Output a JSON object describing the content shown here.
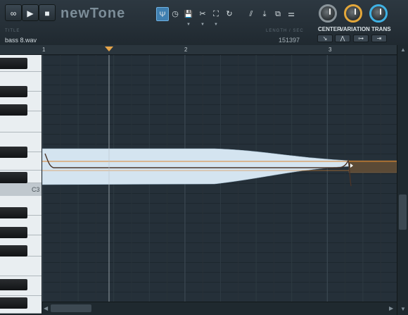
{
  "transport": {
    "loop_icon": "∞",
    "play_icon": "▶",
    "stop_icon": "■"
  },
  "app": {
    "name": "newTone"
  },
  "title": {
    "label": "TITLE",
    "value": "bass 8.wav"
  },
  "length": {
    "label": "LENGTH / SEC",
    "value": "151397"
  },
  "toolbar": {
    "pitch_icon": "Ψ",
    "time_icon": "◷",
    "save_icon": "💾",
    "cut_icon": "✂",
    "select_icon": "⛶",
    "undo_icon": "↻",
    "slice_icon": "⫽",
    "export_icon": "⤓",
    "paste_icon": "⧉",
    "settings_icon": "⚌"
  },
  "knobs": {
    "center": {
      "label": "CENTER",
      "color": "#8a949a"
    },
    "variation": {
      "label": "VARIATION",
      "color": "#e3a73a"
    },
    "trans": {
      "label": "TRANS",
      "color": "#3fb1e3"
    }
  },
  "knob_buttons": {
    "center": "↘",
    "variation": "⋀",
    "trans_left": "⊶",
    "trans_right": "⇥"
  },
  "ruler": {
    "bar1": "1",
    "bar2": "2",
    "bar3": "3"
  },
  "piano": {
    "c3_label": "C3"
  },
  "colors": {
    "note_fill": "#d4e4f0",
    "pitch_line": "#e0892f",
    "grid_bg": "#253039"
  }
}
